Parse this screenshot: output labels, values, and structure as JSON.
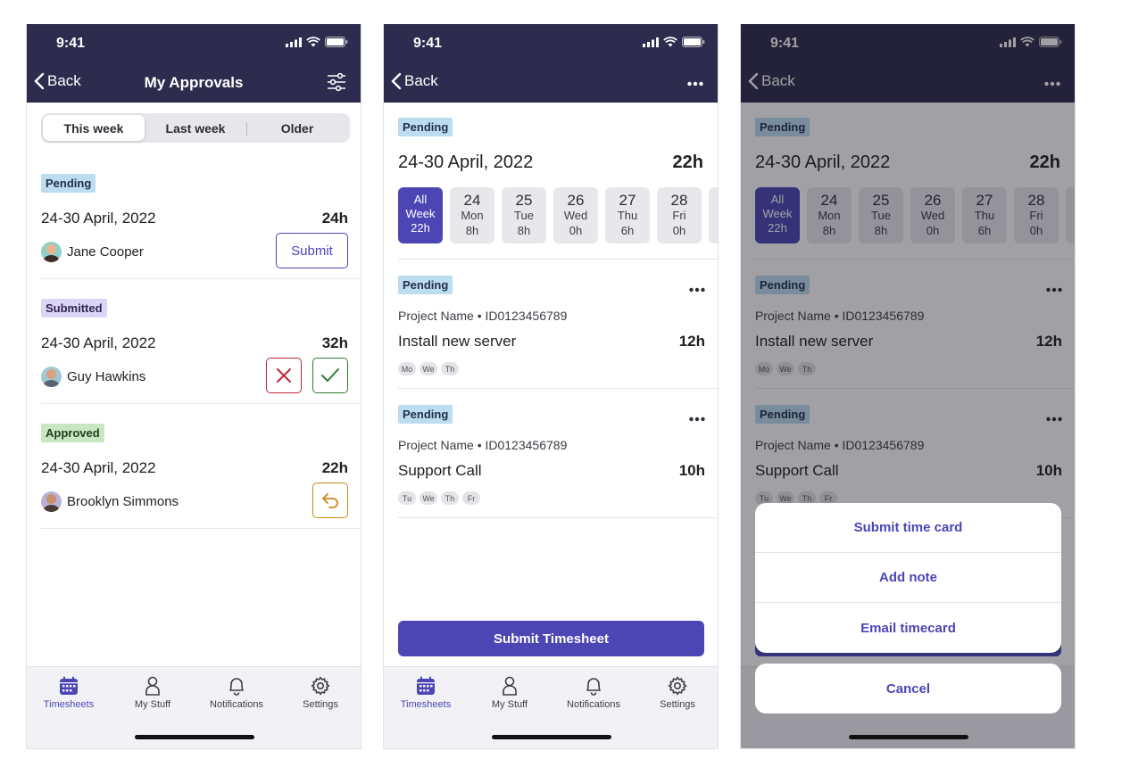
{
  "status_bar": {
    "time": "9:41"
  },
  "nav": {
    "back_label": "Back"
  },
  "colors": {
    "primary": "#4b46b4",
    "header": "#2d2c4e",
    "pending": "#bcdcf0",
    "submitted": "#ddd5f5",
    "approved": "#c8e6c0",
    "reject": "#c0263c",
    "approve": "#2e7d32",
    "return": "#c88a1a"
  },
  "screen1": {
    "title": "My Approvals",
    "segments": [
      "This week",
      "Last week",
      "Older"
    ],
    "cards": [
      {
        "status": "Pending",
        "date": "24-30 April, 2022",
        "hours": "24h",
        "person": "Jane Cooper",
        "action": "Submit"
      },
      {
        "status": "Submitted",
        "date": "24-30 April, 2022",
        "hours": "32h",
        "person": "Guy Hawkins"
      },
      {
        "status": "Approved",
        "date": "24-30 April, 2022",
        "hours": "22h",
        "person": "Brooklyn Simmons"
      }
    ]
  },
  "tabs": [
    "Timesheets",
    "My Stuff",
    "Notifications",
    "Settings"
  ],
  "screen2": {
    "status": "Pending",
    "week": "24-30 April, 2022",
    "week_hours": "22h",
    "all_day": {
      "line1": "All",
      "line2": "Week",
      "hours": "22h"
    },
    "days": [
      {
        "num": "24",
        "dow": "Mon",
        "hours": "8h"
      },
      {
        "num": "25",
        "dow": "Tue",
        "hours": "8h"
      },
      {
        "num": "26",
        "dow": "Wed",
        "hours": "0h"
      },
      {
        "num": "27",
        "dow": "Thu",
        "hours": "6h"
      },
      {
        "num": "28",
        "dow": "Fri",
        "hours": "0h"
      }
    ],
    "tasks": [
      {
        "status": "Pending",
        "project": "Project Name • ID0123456789",
        "name": "Install new server",
        "hours": "12h",
        "days": [
          "Mo",
          "We",
          "Th"
        ]
      },
      {
        "status": "Pending",
        "project": "Project Name • ID0123456789",
        "name": "Support Call",
        "hours": "10h",
        "days": [
          "Tu",
          "We",
          "Th",
          "Fr"
        ]
      }
    ],
    "submit_label": "Submit Timesheet"
  },
  "screen3": {
    "actions": [
      "Submit time card",
      "Add note",
      "Email timecard"
    ],
    "cancel_label": "Cancel"
  }
}
